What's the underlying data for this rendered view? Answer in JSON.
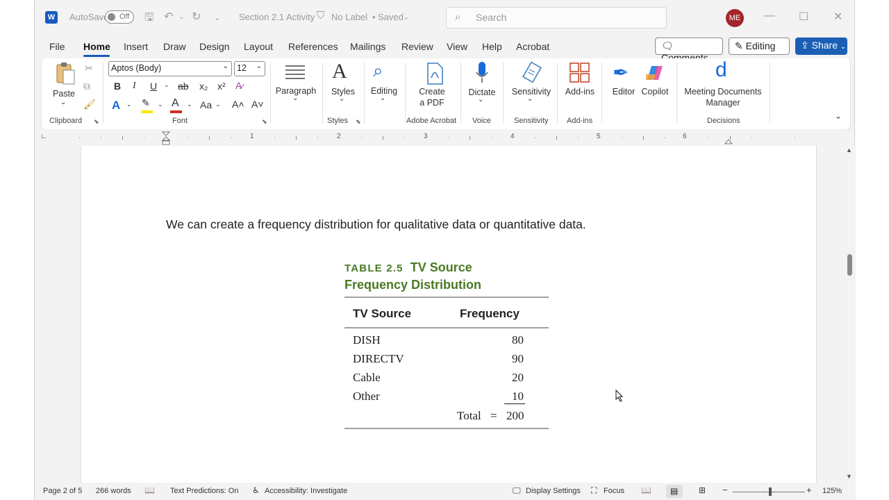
{
  "titlebar": {
    "autosave_label": "AutoSave",
    "autosave_state": "Off",
    "doc_title": "Section 2.1 Activity",
    "label_status": "No Label",
    "save_status": "Saved",
    "search_placeholder": "Search",
    "avatar_initials": "ME"
  },
  "tabs": [
    "File",
    "Home",
    "Insert",
    "Draw",
    "Design",
    "Layout",
    "References",
    "Mailings",
    "Review",
    "View",
    "Help",
    "Acrobat"
  ],
  "actions": {
    "comments": "Comments",
    "editing": "Editing",
    "share": "Share"
  },
  "ribbon": {
    "clipboard": {
      "paste": "Paste",
      "group": "Clipboard"
    },
    "font": {
      "name": "Aptos (Body)",
      "size": "12",
      "group": "Font",
      "bold": "B",
      "italic": "I",
      "underline": "U",
      "strike": "ab",
      "sub": "x₂",
      "sup": "x²",
      "grow": "A˄",
      "shrink": "A˅",
      "case": "Aa"
    },
    "paragraph": {
      "label": "Paragraph"
    },
    "styles": {
      "label": "Styles",
      "group": "Styles"
    },
    "editing": {
      "label": "Editing"
    },
    "acrobat": {
      "label_line1": "Create",
      "label_line2": "a PDF",
      "group": "Adobe Acrobat"
    },
    "voice": {
      "label": "Dictate",
      "group": "Voice"
    },
    "sensitivity": {
      "label": "Sensitivity",
      "group": "Sensitivity"
    },
    "addins": {
      "label": "Add-ins",
      "group": "Add-ins"
    },
    "editor": {
      "label": "Editor"
    },
    "copilot": {
      "label": "Copilot"
    },
    "meeting": {
      "label_line1": "Meeting Documents",
      "label_line2": "Manager",
      "group": "Decisions"
    }
  },
  "ruler_numbers": [
    "1",
    "2",
    "3",
    "4",
    "5",
    "6"
  ],
  "document": {
    "paragraph": "We can create a frequency distribution for qualitative data or quantitative data.",
    "table": {
      "label": "TABLE 2.5",
      "title_part1": "TV Source",
      "title_part2": "Frequency Distribution",
      "headers": [
        "TV Source",
        "Frequency"
      ],
      "rows": [
        {
          "source": "DISH",
          "frequency": "80"
        },
        {
          "source": "DIRECTV",
          "frequency": "90"
        },
        {
          "source": "Cable",
          "frequency": "20"
        },
        {
          "source": "Other",
          "frequency": "10"
        }
      ],
      "total_label": "Total",
      "equals": "=",
      "total_value": "200"
    }
  },
  "statusbar": {
    "page": "Page 2 of 5",
    "words": "266 words",
    "text_predictions": "Text Predictions: On",
    "accessibility": "Accessibility: Investigate",
    "display_settings": "Display Settings",
    "focus": "Focus",
    "zoom": "125%"
  }
}
